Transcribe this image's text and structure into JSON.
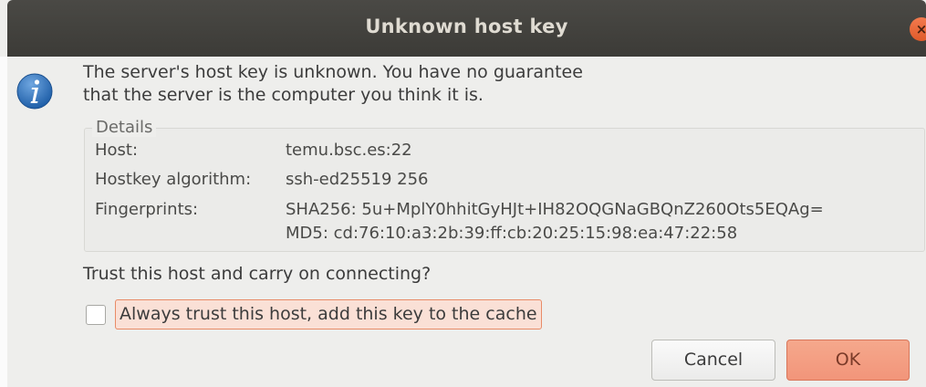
{
  "window": {
    "title": "Unknown host key",
    "close_glyph": "×"
  },
  "icon": {
    "name": "info-icon",
    "color": "#2c6fb7"
  },
  "message": {
    "line1": "The server's host key is unknown. You have no guarantee",
    "line2": "that the server is the computer you think it is."
  },
  "details": {
    "legend": "Details",
    "host_label": "Host:",
    "host_value": "temu.bsc.es:22",
    "algorithm_label": "Hostkey algorithm:",
    "algorithm_value": "ssh-ed25519 256",
    "fingerprints_label": "Fingerprints:",
    "fingerprint_sha256": "SHA256: 5u+MplY0hhitGyHJt+IH82OQGNaGBQnZ260Ots5EQAg=",
    "fingerprint_md5": "MD5: cd:76:10:a3:2b:39:ff:cb:20:25:15:98:ea:47:22:58"
  },
  "question": "Trust this host and carry on connecting?",
  "always_trust": {
    "label": "Always trust this host, add this key to the cache",
    "checked": false
  },
  "buttons": {
    "cancel": "Cancel",
    "ok": "OK"
  }
}
